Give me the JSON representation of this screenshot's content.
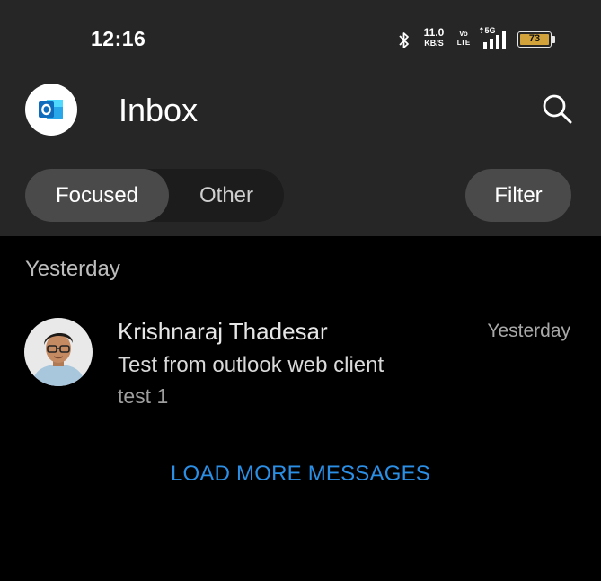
{
  "status_bar": {
    "time": "12:16",
    "net_speed": "11.0",
    "net_speed_unit": "KB/S",
    "volte_line1": "Vo",
    "volte_line2": "LTE",
    "network": "5G",
    "battery": "73",
    "icons": [
      "bluetooth-icon",
      "signal-icon",
      "battery-icon"
    ]
  },
  "header": {
    "title": "Inbox",
    "app_icon": "outlook-icon",
    "search_icon": "search-icon"
  },
  "tabs": [
    {
      "label": "Focused",
      "selected": true
    },
    {
      "label": "Other",
      "selected": false
    }
  ],
  "filter_label": "Filter",
  "section": "Yesterday",
  "messages": [
    {
      "sender": "Krishnaraj Thadesar",
      "date": "Yesterday",
      "subject": "Test from outlook web client",
      "preview": "test 1"
    }
  ],
  "load_more": "LOAD MORE MESSAGES",
  "colors": {
    "header_bg": "#262626",
    "list_bg": "#000000",
    "accent": "#2b8fe6",
    "outlook_blue": "#0f6cbd"
  }
}
